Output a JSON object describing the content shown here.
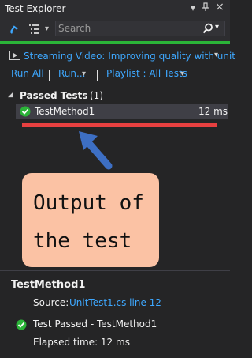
{
  "window": {
    "title": "Test Explorer",
    "controls": {
      "dropdown": "▾",
      "pin": "⊥",
      "close": "×"
    }
  },
  "toolbar": {
    "search_placeholder": "Search",
    "group_by_caret": "▾",
    "search_caret": "▾"
  },
  "playlist_bar": {
    "label": "Streaming Video: Improving quality with unit",
    "caret": "▾"
  },
  "actions": {
    "run_all": "Run All",
    "run": "Run...",
    "run_caret": "▾",
    "playlist": "Playlist : All Tests",
    "playlist_caret": "▾"
  },
  "group": {
    "expander": "◢",
    "label": "Passed Tests",
    "count": "(1)"
  },
  "tests": [
    {
      "name": "TestMethod1",
      "duration": "12 ms",
      "status": "passed"
    }
  ],
  "annotation": {
    "line1": "Output of",
    "line2": "the test"
  },
  "detail": {
    "title": "TestMethod1",
    "source_label": "Source:",
    "source_link": "UnitTest1.cs line 12",
    "status_text": "Test Passed - TestMethod1",
    "elapsed_text": "Elapsed time: 12 ms"
  },
  "colors": {
    "accent_link": "#3ea8ff",
    "success_green": "#2bb438",
    "annotation_red": "#e84040",
    "annotation_note": "#fbc2a4",
    "annotation_arrow": "#3d6fc4"
  }
}
